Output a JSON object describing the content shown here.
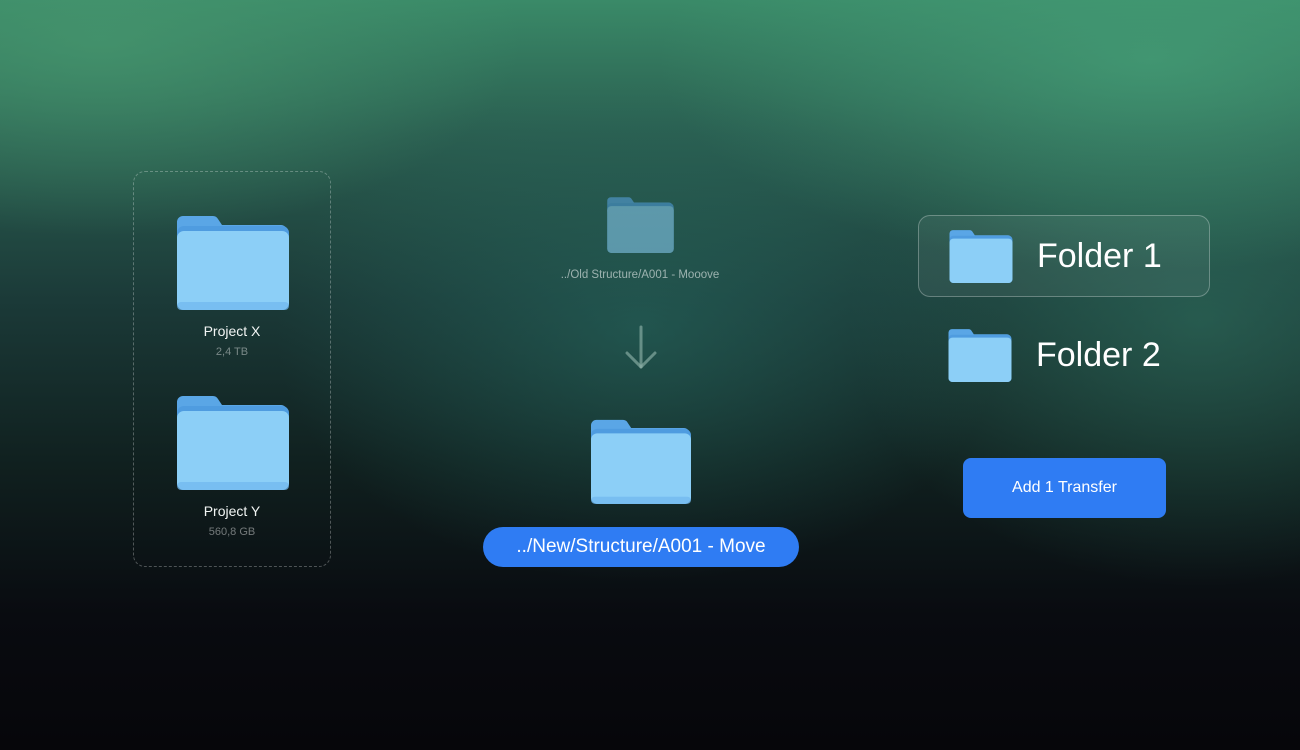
{
  "source": {
    "projects": [
      {
        "name": "Project X",
        "size": "2,4 TB"
      },
      {
        "name": "Project Y",
        "size": "560,8 GB"
      }
    ]
  },
  "transfer": {
    "old_path": "../Old Structure/A001 - Mooove",
    "new_path": "../New/Structure/A001 - Move"
  },
  "destination": {
    "folders": [
      {
        "label": "Folder 1",
        "selected": true
      },
      {
        "label": "Folder 2",
        "selected": false
      }
    ],
    "add_button_label": "Add 1 Transfer"
  },
  "colors": {
    "accent": "#2f7cf3",
    "folder_body": "#8ccff7",
    "folder_tab": "#5aa6e6"
  },
  "icons": {
    "folder": "folder-icon",
    "arrow": "arrow-down-icon"
  }
}
